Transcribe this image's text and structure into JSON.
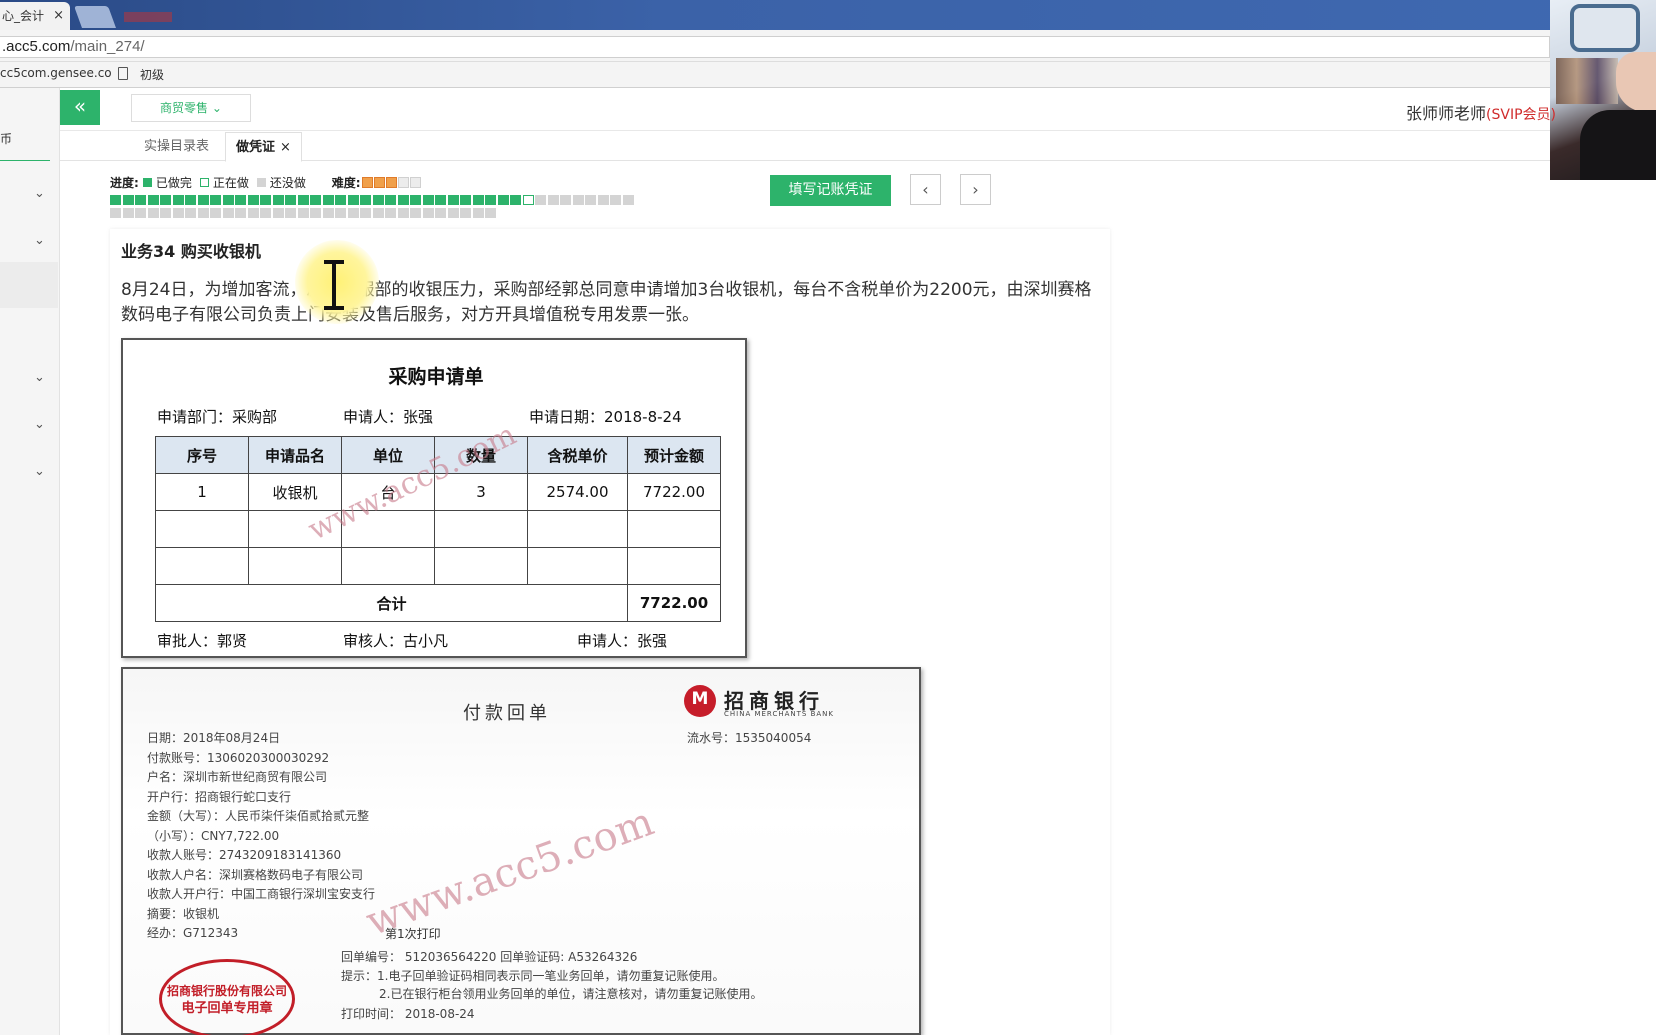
{
  "browser": {
    "tab_title": "心_会计",
    "tab_close": "×",
    "url_host": ".acc5.com",
    "url_path": "/main_274/",
    "bookmarks": [
      "cc5com.gensee.co",
      "初级"
    ]
  },
  "sidebar": {
    "char": "币"
  },
  "header": {
    "collapse_icon": "«",
    "category": "商贸零售",
    "user_name": "张师师老师",
    "user_role": "(SVIP会员)"
  },
  "page_tabs": [
    {
      "label": "实操目录表"
    },
    {
      "label": "做凭证",
      "close": "×"
    }
  ],
  "progress": {
    "label": "进度:",
    "done": "已做完",
    "doing": "正在做",
    "todo": "还没做",
    "difficulty_label": "难度:",
    "difficulty": 3,
    "difficulty_max": 5,
    "total": 73,
    "done_count": 33,
    "current": 34,
    "colors": {
      "done": "#2db36b",
      "todo": "#d4d4d4"
    }
  },
  "toolbar": {
    "fill_button": "填写记账凭证",
    "prev": "‹",
    "next": "›"
  },
  "task": {
    "title": "业务34 购买收银机",
    "description": "8月24日，为增加客流，减少客服部的收银压力，采购部经郭总同意申请增加3台收银机，每台不含税单价为2200元，由深圳赛格数码电子有限公司负责上门安装及售后服务，对方开具增值税专用发票一张。"
  },
  "purchase_form": {
    "title": "采购申请单",
    "dept": "申请部门：采购部",
    "applicant": "申请人：张强",
    "date": "申请日期：2018-8-24",
    "columns": [
      "序号",
      "申请品名",
      "单位",
      "数量",
      "含税单价",
      "预计金额"
    ],
    "rows": [
      [
        "1",
        "收银机",
        "台",
        "3",
        "2574.00",
        "7722.00"
      ],
      [
        "",
        "",
        "",
        "",
        "",
        ""
      ],
      [
        "",
        "",
        "",
        "",
        "",
        ""
      ]
    ],
    "total_label": "合计",
    "total_value": "7722.00",
    "approver": "审批人：郭贤",
    "reviewer": "审核人：古小凡",
    "requester": "申请人：张强",
    "watermark": "www.acc5.com"
  },
  "bank_slip": {
    "title": "付款回单",
    "bank_name": "招商银行",
    "bank_en": "CHINA MERCHANTS BANK",
    "serial": "流水号：1535040054",
    "lines": [
      "日期：2018年08月24日",
      "付款账号：1306020300030292",
      "户名：深圳市新世纪商贸有限公司",
      "开户行：招商银行蛇口支行",
      "金额（大写）：人民币柒仟柒佰贰拾贰元整",
      "（小写）：CNY7,722.00",
      "收款人账号：2743209183141360",
      "收款人户名：深圳赛格数码电子有限公司",
      "收款人开户行：中国工商银行深圳宝安支行",
      "摘要：收银机",
      "经办：G712343"
    ],
    "print_count": "第1次打印",
    "receipt_no": "回单编号： 512036564220 回单验证码: A53264326",
    "notes": [
      "提示：1.电子回单验证码相同表示同一笔业务回单，请勿重复记账使用。",
      "2.已在银行柜台领用业务回单的单位，请注意核对，请勿重复记账使用。"
    ],
    "print_time": "打印时间： 2018-08-24",
    "stamp": [
      "招商银行股份有限公司",
      "电子回单专用章"
    ],
    "watermark": "www.acc5.com"
  }
}
